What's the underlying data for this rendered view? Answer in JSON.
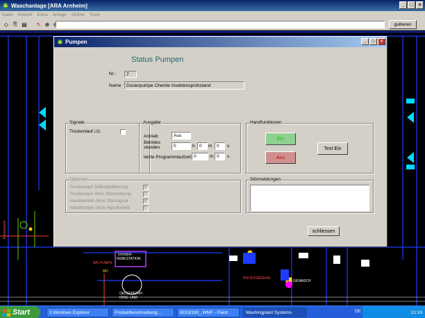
{
  "app": {
    "title": "Waschanlage [ARA Arnheim]",
    "menu": [
      "Datei",
      "Ansicht",
      "Extra",
      "Anlage",
      "Online",
      "Tools"
    ],
    "toolbar_button": "gultieren"
  },
  "dialog": {
    "title": "Pumpen",
    "heading": "Status Pumpen",
    "nr_label": "Nr.:",
    "nr_value": "7",
    "name_label": "Name",
    "name_value": "Dosierpumpe Chemie Insektensprühstand",
    "signale": {
      "label": "Signale",
      "trockenlauf_label": "Trockenlauf i.O."
    },
    "ausgabe": {
      "label": "Ausgabe",
      "antrieb_label": "Antrieb",
      "antrieb_value": "Aus",
      "betriebsstunden_label1": "Betriebs",
      "betriebsstunden_label2": "stunden",
      "h_value": "0",
      "h_unit": "h",
      "m_value": "0",
      "m_unit": "m",
      "s_value": "0",
      "s_unit": "s",
      "programm_label": "letzte Programmlaufzeit",
      "p_m_value": "0",
      "p_m_unit": "m",
      "p_s_value": "0",
      "p_s_unit": "s"
    },
    "handfunktionen": {
      "label": "Handfunktionen",
      "ein": "Ein",
      "aus": "Aus",
      "test_ein": "Test Ein"
    },
    "optionen": {
      "label": "Optionen",
      "items": [
        {
          "label": "Trockenlauf Selbstquittierung",
          "checked": true
        },
        {
          "label": "Trockenlauf ohne Störmeldung",
          "checked": false
        },
        {
          "label": "Handbetrieb ohne Startsignal",
          "checked": true
        },
        {
          "label": "Handbetrieb ohne Handbefehl",
          "checked": false
        }
      ]
    },
    "stoermeldungen_label": "Störmeldungen",
    "close_button": "schliessen"
  },
  "cad_labels": {
    "a": "WD-PUMPE",
    "b": "DOSIER-",
    "c": "REBESTATION",
    "d": "MD",
    "e": "OELSEPERAT-",
    "f": "IONS- UND",
    "g": "PW-DOSIERUNG",
    "h": "GEWASCH",
    "i": "Kompressor"
  },
  "taskbar": {
    "start": "Start",
    "tasks": [
      "3 Windows Explorer",
      "Produktbeschreibung....",
      "BD18190_.WMF - Paint",
      "Washingplant Systems"
    ],
    "lang": "DE",
    "clock": "21:19"
  },
  "colors": {
    "title_bar": "#0a246a",
    "heading": "#1c6b6b",
    "ein_green": "#8fcf8f",
    "aus_red": "#cf8f8f"
  }
}
